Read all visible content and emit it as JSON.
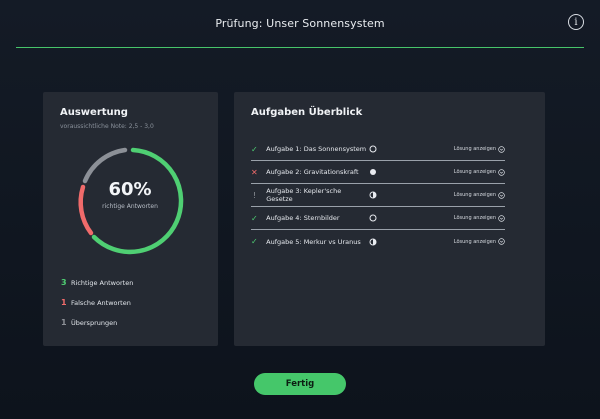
{
  "header": {
    "title": "Prüfung: Unser Sonnensystem",
    "info_icon": "info-icon",
    "info_glyph": "i"
  },
  "colors": {
    "accent": "#45c76a",
    "correct": "#4fcf73",
    "wrong": "#f06b6b",
    "skipped": "#8c9097",
    "card": "#252a33"
  },
  "evaluation": {
    "title": "Auswertung",
    "subtitle": "voraussichtliche Note: 2,5 - 3,0",
    "percent": "60%",
    "percent_label": "richtige Antworten",
    "stats": [
      {
        "count": "3",
        "label": "Richtige Antworten",
        "kind": "correct"
      },
      {
        "count": "1",
        "label": "Falsche Antworten",
        "kind": "wrong"
      },
      {
        "count": "1",
        "label": "Übersprungen",
        "kind": "skipped"
      }
    ]
  },
  "overview": {
    "title": "Aufgaben Überblick",
    "solution_label": "Lösung anzeigen",
    "tasks": [
      {
        "label": "Aufgabe 1: Das Sonnensystem",
        "result": "correct",
        "result_glyph": "✓",
        "state": "empty-circle-icon"
      },
      {
        "label": "Aufgabe 2: Gravitationskraft",
        "result": "wrong",
        "result_glyph": "✕",
        "state": "filled-circle-icon"
      },
      {
        "label": "Aufgabe 3: Kepler'sche Gesetze",
        "result": "skipped",
        "result_glyph": "!",
        "state": "half-circle-icon"
      },
      {
        "label": "Aufgabe 4: Sternbilder",
        "result": "correct",
        "result_glyph": "✓",
        "state": "empty-circle-icon"
      },
      {
        "label": "Aufgabe 5: Merkur vs Uranus",
        "result": "correct",
        "result_glyph": "✓",
        "state": "half-circle-icon"
      }
    ]
  },
  "finish_button": "Fertig"
}
